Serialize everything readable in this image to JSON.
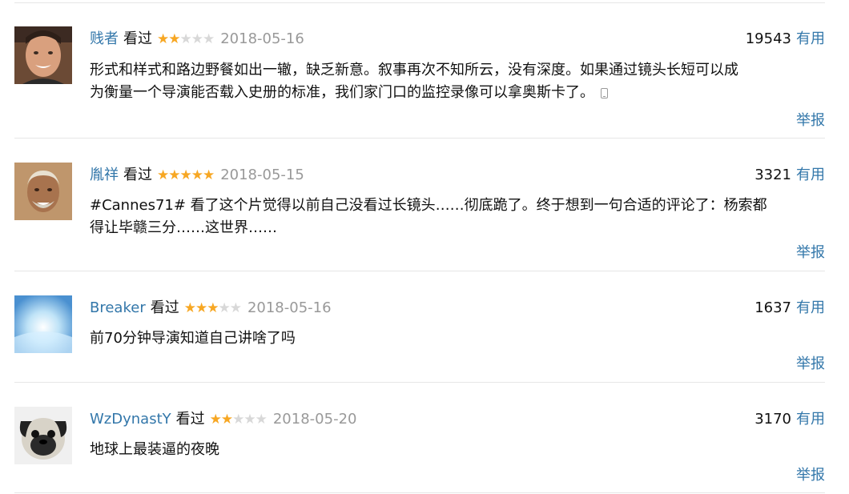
{
  "comments": [
    {
      "user": "贱者",
      "status": "看过",
      "rating": 2,
      "date": "2018-05-16",
      "votes": "19543",
      "useful_label": "有用",
      "content_lines": [
        "形式和样式和路边野餐如出一辙，缺乏新意。叙事再次不知所云，没有深度。如果通过镜头长短可以成",
        "为衡量一个导演能否载入史册的标准，我们家门口的监控录像可以拿奥斯卡了。"
      ],
      "report_label": "举报",
      "from_mobile_icon": "phone-icon"
    },
    {
      "user": "胤祥",
      "status": "看过",
      "rating": 5,
      "date": "2018-05-15",
      "votes": "3321",
      "useful_label": "有用",
      "content_lines": [
        "#Cannes71# 看了这个片觉得以前自己没看过长镜头……彻底跪了。终于想到一句合适的评论了：杨索都",
        "得让毕赣三分……这世界……"
      ],
      "report_label": "举报"
    },
    {
      "user": "Breaker",
      "status": "看过",
      "rating": 3,
      "date": "2018-05-16",
      "votes": "1637",
      "useful_label": "有用",
      "content_lines": [
        "前70分钟导演知道自己讲啥了吗"
      ],
      "report_label": "举报"
    },
    {
      "user": "WzDynastY",
      "status": "看过",
      "rating": 2,
      "date": "2018-05-20",
      "votes": "3170",
      "useful_label": "有用",
      "content_lines": [
        "地球上最装逼的夜晚"
      ],
      "report_label": "举报"
    }
  ],
  "colors": {
    "link": "#3377aa",
    "star_on": "#f7a723",
    "star_off": "#d8d8d8",
    "date": "#999999",
    "divider": "#e6e6e6"
  }
}
